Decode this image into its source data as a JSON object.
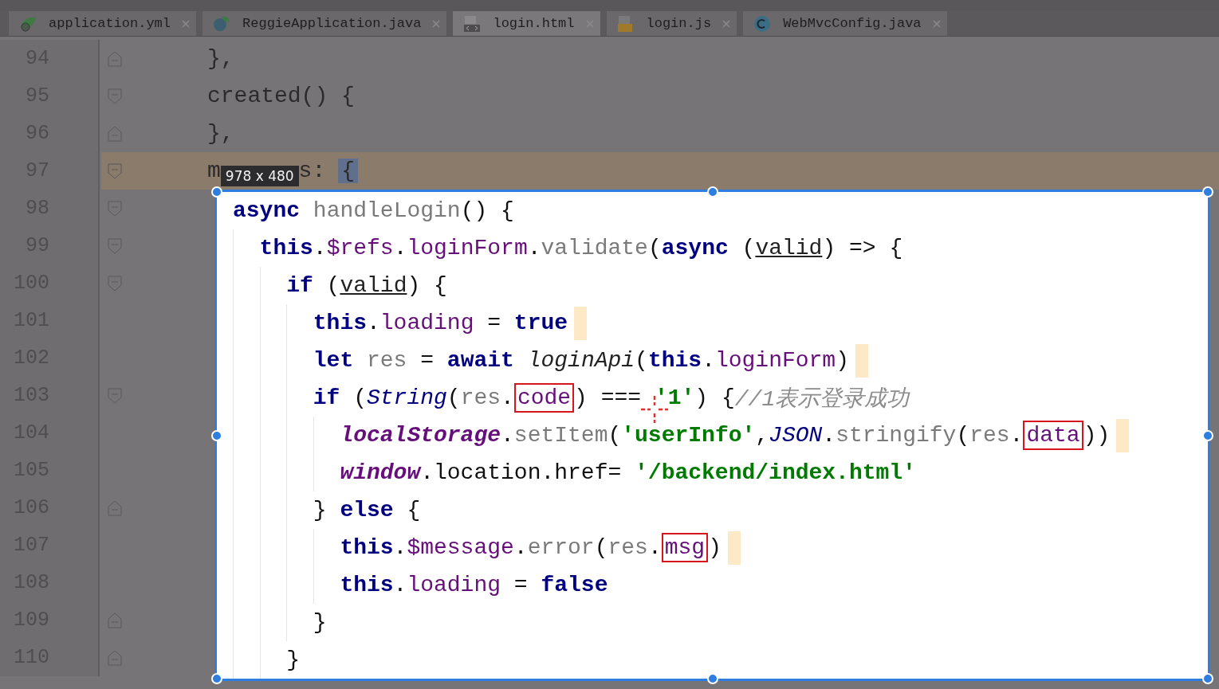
{
  "tabs": [
    {
      "label": "application.yml",
      "selected": false
    },
    {
      "label": "ReggieApplication.java",
      "selected": false
    },
    {
      "label": "login.html",
      "selected": true
    },
    {
      "label": "login.js",
      "selected": false
    },
    {
      "label": "WebMvcConfig.java",
      "selected": false
    }
  ],
  "editor": {
    "lines": [
      {
        "number": "94",
        "text": "},",
        "kind": "closer",
        "current": false
      },
      {
        "number": "95",
        "text": "created() {",
        "kind": "opener",
        "current": false
      },
      {
        "number": "96",
        "text": "},",
        "kind": "closer",
        "current": false
      },
      {
        "number": "97",
        "text": "m",
        "badge": "978 x 480",
        "after": "s:",
        "brace": "{",
        "kind": "opener",
        "current": true
      }
    ],
    "selection": {
      "lines": [
        {
          "number": "98",
          "kind": "opener",
          "trailing_mark": false,
          "tokens": [
            {
              "text": "async ",
              "kind": "keyword"
            },
            {
              "text": "handleLogin",
              "kind": "method"
            },
            {
              "text": "() {",
              "kind": "plain"
            }
          ],
          "children": [
            {
              "number": "99",
              "kind": "opener",
              "trailing_mark": false,
              "tokens": [
                {
                  "text": "this",
                  "kind": "keyword"
                },
                {
                  "text": ".",
                  "kind": "plain"
                },
                {
                  "text": "$refs",
                  "kind": "property"
                },
                {
                  "text": ".",
                  "kind": "plain"
                },
                {
                  "text": "loginForm",
                  "kind": "property"
                },
                {
                  "text": ".",
                  "kind": "plain"
                },
                {
                  "text": "validate",
                  "kind": "method"
                },
                {
                  "text": "(",
                  "kind": "plain"
                },
                {
                  "text": "async ",
                  "kind": "keyword"
                },
                {
                  "text": "(",
                  "kind": "plain"
                },
                {
                  "text": "valid",
                  "kind": "parameter"
                },
                {
                  "text": ") => {",
                  "kind": "plain"
                }
              ],
              "children": [
                {
                  "number": "100",
                  "kind": "opener",
                  "trailing_mark": false,
                  "tokens": [
                    {
                      "text": "if ",
                      "kind": "keyword"
                    },
                    {
                      "text": "(",
                      "kind": "plain"
                    },
                    {
                      "text": "valid",
                      "kind": "parameter"
                    },
                    {
                      "text": ") {",
                      "kind": "plain"
                    }
                  ],
                  "children": [
                    {
                      "number": "101",
                      "trailing_mark": true,
                      "tokens": [
                        {
                          "text": "this",
                          "kind": "keyword"
                        },
                        {
                          "text": ".",
                          "kind": "plain"
                        },
                        {
                          "text": "loading",
                          "kind": "property"
                        },
                        {
                          "text": " = ",
                          "kind": "plain"
                        },
                        {
                          "text": "true",
                          "kind": "keyword"
                        }
                      ]
                    },
                    {
                      "number": "102",
                      "trailing_mark": true,
                      "tokens": [
                        {
                          "text": "let ",
                          "kind": "keyword"
                        },
                        {
                          "text": "res",
                          "kind": "variable"
                        },
                        {
                          "text": " = ",
                          "kind": "plain"
                        },
                        {
                          "text": "await ",
                          "kind": "keyword"
                        },
                        {
                          "text": "loginApi",
                          "kind": "function"
                        },
                        {
                          "text": "(",
                          "kind": "plain"
                        },
                        {
                          "text": "this",
                          "kind": "keyword"
                        },
                        {
                          "text": ".",
                          "kind": "plain"
                        },
                        {
                          "text": "loginForm",
                          "kind": "property"
                        },
                        {
                          "text": ")",
                          "kind": "plain"
                        }
                      ]
                    },
                    {
                      "number": "103",
                      "kind": "opener",
                      "trailing_mark": false,
                      "tokens": [
                        {
                          "text": "if ",
                          "kind": "keyword"
                        },
                        {
                          "text": "(",
                          "kind": "plain"
                        },
                        {
                          "text": "String",
                          "kind": "global"
                        },
                        {
                          "text": "(",
                          "kind": "plain"
                        },
                        {
                          "text": "res",
                          "kind": "variable"
                        },
                        {
                          "text": ".",
                          "kind": "plain"
                        },
                        {
                          "text": "code",
                          "kind": "property",
                          "boxed": true
                        },
                        {
                          "text": ") === ",
                          "kind": "plain"
                        },
                        {
                          "text": "'1'",
                          "kind": "string"
                        },
                        {
                          "text": ") {",
                          "kind": "plain"
                        },
                        {
                          "text": "//1表示登录成功",
                          "kind": "comment"
                        }
                      ],
                      "children": [
                        {
                          "number": "104",
                          "trailing_mark": true,
                          "tokens": [
                            {
                              "text": "localStorage",
                              "kind": "object"
                            },
                            {
                              "text": ".",
                              "kind": "plain"
                            },
                            {
                              "text": "setItem",
                              "kind": "method"
                            },
                            {
                              "text": "(",
                              "kind": "plain"
                            },
                            {
                              "text": "'userInfo'",
                              "kind": "string"
                            },
                            {
                              "text": ",",
                              "kind": "plain"
                            },
                            {
                              "text": "JSON",
                              "kind": "global"
                            },
                            {
                              "text": ".",
                              "kind": "plain"
                            },
                            {
                              "text": "stringify",
                              "kind": "method"
                            },
                            {
                              "text": "(",
                              "kind": "plain"
                            },
                            {
                              "text": "res",
                              "kind": "variable"
                            },
                            {
                              "text": ".",
                              "kind": "plain"
                            },
                            {
                              "text": "data",
                              "kind": "property",
                              "boxed": true
                            },
                            {
                              "text": "))",
                              "kind": "plain"
                            }
                          ]
                        },
                        {
                          "number": "105",
                          "trailing_mark": false,
                          "tokens": [
                            {
                              "text": "window",
                              "kind": "object"
                            },
                            {
                              "text": ".location.href= ",
                              "kind": "plain"
                            },
                            {
                              "text": "'/backend/index.html'",
                              "kind": "string"
                            }
                          ]
                        }
                      ]
                    },
                    {
                      "number": "106",
                      "kind": "closer",
                      "trailing_mark": false,
                      "tokens": [
                        {
                          "text": "} ",
                          "kind": "plain"
                        },
                        {
                          "text": "else ",
                          "kind": "keyword"
                        },
                        {
                          "text": "{",
                          "kind": "plain"
                        }
                      ],
                      "children": [
                        {
                          "number": "107",
                          "trailing_mark": true,
                          "tokens": [
                            {
                              "text": "this",
                              "kind": "keyword"
                            },
                            {
                              "text": ".",
                              "kind": "plain"
                            },
                            {
                              "text": "$message",
                              "kind": "property"
                            },
                            {
                              "text": ".",
                              "kind": "plain"
                            },
                            {
                              "text": "error",
                              "kind": "method"
                            },
                            {
                              "text": "(",
                              "kind": "plain"
                            },
                            {
                              "text": "res",
                              "kind": "variable"
                            },
                            {
                              "text": ".",
                              "kind": "plain"
                            },
                            {
                              "text": "msg",
                              "kind": "property",
                              "boxed": true
                            },
                            {
                              "text": ")",
                              "kind": "plain"
                            }
                          ]
                        },
                        {
                          "number": "108",
                          "trailing_mark": false,
                          "tokens": [
                            {
                              "text": "this",
                              "kind": "keyword"
                            },
                            {
                              "text": ".",
                              "kind": "plain"
                            },
                            {
                              "text": "loading",
                              "kind": "property"
                            },
                            {
                              "text": " = ",
                              "kind": "plain"
                            },
                            {
                              "text": "false",
                              "kind": "keyword"
                            }
                          ]
                        }
                      ]
                    },
                    {
                      "number": "109",
                      "kind": "closer",
                      "trailing_mark": false,
                      "tokens": [
                        {
                          "text": "}",
                          "kind": "plain"
                        }
                      ]
                    }
                  ]
                },
                {
                  "number": "110",
                  "kind": "closer",
                  "trailing_mark": false,
                  "tokens": [
                    {
                      "text": "}",
                      "kind": "plain"
                    }
                  ]
                }
              ]
            }
          ]
        }
      ]
    }
  }
}
